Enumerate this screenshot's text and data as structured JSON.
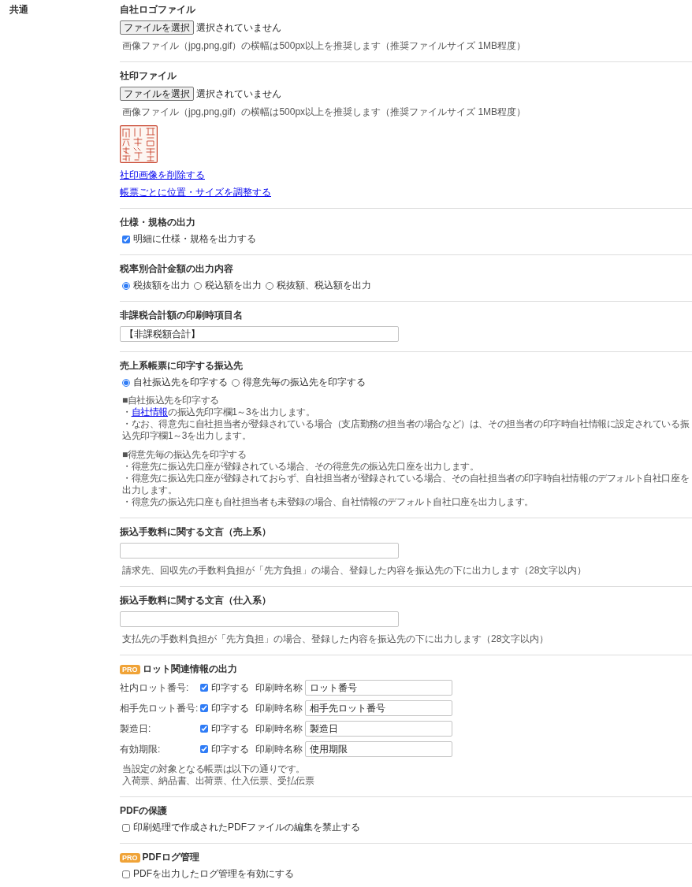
{
  "side_label": "共通",
  "sections": [
    {
      "title": "自社ロゴファイル",
      "items": [
        {
          "kind": "file",
          "button": "ファイルを選択",
          "status": "選択されていません"
        },
        {
          "kind": "note",
          "text": "画像ファイル（jpg,png,gif）の横幅は500px以上を推奨します（推奨ファイルサイズ 1MB程度）"
        }
      ]
    },
    {
      "title": "社印ファイル",
      "items": [
        {
          "kind": "file",
          "button": "ファイルを選択",
          "status": "選択されていません"
        },
        {
          "kind": "note",
          "text": "画像ファイル（jpg,png,gif）の横幅は500px以上を推奨します（推奨ファイルサイズ 1MB程度）"
        },
        {
          "kind": "seal_image"
        },
        {
          "kind": "link",
          "text": "社印画像を削除する"
        },
        {
          "kind": "link",
          "text": "帳票ごとに位置・サイズを調整する"
        }
      ]
    },
    {
      "title": "仕様・規格の出力",
      "items": [
        {
          "kind": "checkbox",
          "label": "明細に仕様・規格を出力する",
          "checked": true
        }
      ]
    },
    {
      "title": "税率別合計金額の出力内容",
      "items": [
        {
          "kind": "radios",
          "options": [
            {
              "label": "税抜額を出力",
              "selected": true
            },
            {
              "label": "税込額を出力",
              "selected": false
            },
            {
              "label": "税抜額、税込額を出力",
              "selected": false
            }
          ]
        }
      ]
    },
    {
      "title": "非課税合計額の印刷時項目名",
      "items": [
        {
          "kind": "text_field",
          "value": "【非課税額合計】"
        }
      ]
    },
    {
      "title": "売上系帳票に印字する振込先",
      "items": [
        {
          "kind": "radios",
          "options": [
            {
              "label": "自社振込先を印字する",
              "selected": true
            },
            {
              "label": "得意先毎の振込先を印字する",
              "selected": false
            }
          ]
        },
        {
          "kind": "notes",
          "groups": [
            {
              "lines": [
                {
                  "text": "■自社振込先を印字する"
                },
                {
                  "prefix": "・",
                  "link": "自社情報",
                  "text": "の振込先印字欄1～3を出力します。"
                },
                {
                  "text": "・なお、得意先に自社担当者が登録されている場合（支店勤務の担当者の場合など）は、その担当者の印字時自社情報に設定されている振込先印字欄1～3を出力します。"
                }
              ]
            },
            {
              "lines": [
                {
                  "text": "■得意先毎の振込先を印字する"
                },
                {
                  "text": "・得意先に振込先口座が登録されている場合、その得意先の振込先口座を出力します。"
                },
                {
                  "text": "・得意先に振込先口座が登録されておらず、自社担当者が登録されている場合、その自社担当者の印字時自社情報のデフォルト自社口座を出力します。"
                },
                {
                  "text": "・得意先の振込先口座も自社担当者も未登録の場合、自社情報のデフォルト自社口座を出力します。"
                }
              ]
            }
          ]
        }
      ]
    },
    {
      "title": "振込手数料に関する文言（売上系）",
      "items": [
        {
          "kind": "text_field"
        },
        {
          "kind": "note",
          "text": "請求先、回収先の手数料負担が「先方負担」の場合、登録した内容を振込先の下に出力します（28文字以内）"
        }
      ]
    },
    {
      "title": "振込手数料に関する文言（仕入系）",
      "items": [
        {
          "kind": "text_field"
        },
        {
          "kind": "note",
          "text": "支払先の手数料負担が「先方負担」の場合、登録した内容を振込先の下に出力します（28文字以内）"
        }
      ]
    },
    {
      "badge": "PRO",
      "title": "ロット関連情報の出力",
      "items": [
        {
          "kind": "lot_rows",
          "rows": [
            {
              "label": "社内ロット番号:",
              "checkbox_label": "印字する",
              "checked": true,
              "name_label": "印刷時名称",
              "value": "ロット番号"
            },
            {
              "label": "相手先ロット番号:",
              "checkbox_label": "印字する",
              "checked": true,
              "name_label": "印刷時名称",
              "value": "相手先ロット番号"
            },
            {
              "label": "製造日:",
              "checkbox_label": "印字する",
              "checked": true,
              "name_label": "印刷時名称",
              "value": "製造日"
            },
            {
              "label": "有効期限:",
              "checkbox_label": "印字する",
              "checked": true,
              "name_label": "印刷時名称",
              "value": "使用期限"
            }
          ]
        },
        {
          "kind": "notes",
          "groups": [
            {
              "lines": [
                {
                  "text": "当設定の対象となる帳票は以下の通りです。"
                },
                {
                  "text": "入荷票、納品書、出荷票、仕入伝票、受払伝票"
                }
              ]
            }
          ]
        }
      ]
    },
    {
      "title": "PDFの保護",
      "items": [
        {
          "kind": "checkbox",
          "label": "印刷処理で作成されたPDFファイルの編集を禁止する",
          "checked": false
        }
      ]
    },
    {
      "badge": "PRO",
      "title": "PDFログ管理",
      "items": [
        {
          "kind": "checkbox",
          "label": "PDFを出力したログ管理を有効にする",
          "checked": false
        }
      ]
    }
  ]
}
